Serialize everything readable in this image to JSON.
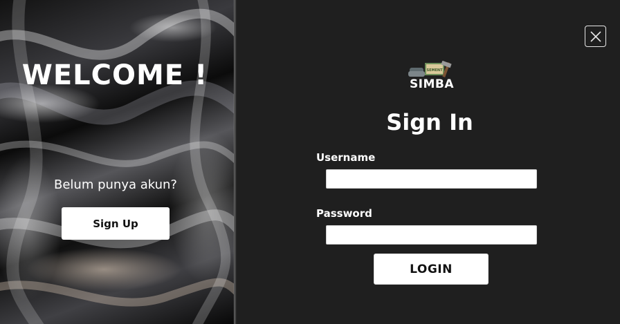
{
  "left": {
    "welcome": "WELCOME !",
    "no_account_text": "Belum punya akun?",
    "signup_label": "Sign Up"
  },
  "right": {
    "logo": {
      "text": "SIMBA",
      "sign_text": "SEMENT",
      "icon": "cement-hammer-logo"
    },
    "title": "Sign In",
    "username_label": "Username",
    "username_value": "",
    "password_label": "Password",
    "password_value": "",
    "login_label": "LOGIN",
    "close_icon": "close-icon"
  },
  "colors": {
    "background": "#1f1f1f",
    "button": "#ffffff",
    "text": "#ffffff"
  }
}
